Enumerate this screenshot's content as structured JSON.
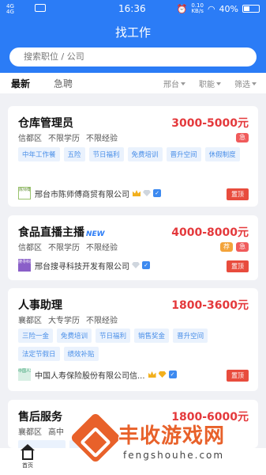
{
  "status_bar": {
    "signal_1": "4G",
    "signal_2": "4G",
    "time": "16:36",
    "speed_value": "0.10",
    "speed_unit": "KB/s",
    "battery": "40%",
    "battery_level": 0.4
  },
  "header": {
    "title": "找工作",
    "search_placeholder": "搜索职位 / 公司"
  },
  "tabs": {
    "latest": "最新",
    "urgent": "急聘",
    "filters": [
      "邢台",
      "职能",
      "筛选"
    ]
  },
  "jobs": [
    {
      "title": "仓库管理员",
      "new_badge": "",
      "salary": "3000-5000元",
      "requirements": [
        "信都区",
        "不限学历",
        "不限经验"
      ],
      "badges": [
        "急"
      ],
      "tags": [
        "中年工作餐",
        "五险",
        "节日福利",
        "免费培训",
        "晋升空间",
        "休假制度"
      ],
      "company": "邢台市陈师傅商贸有限公司",
      "logo_text": "陈师傅",
      "pin_label": "置顶"
    },
    {
      "title": "食品直播主播",
      "new_badge": "NEW",
      "salary": "4000-8000元",
      "requirements": [
        "信都区",
        "不限学历",
        "不限经验"
      ],
      "badges": [
        "荐",
        "急"
      ],
      "tags": [],
      "company": "邢台搜寻科技开发有限公司",
      "logo_text": "搜寻科技",
      "pin_label": "置顶"
    },
    {
      "title": "人事助理",
      "new_badge": "",
      "salary": "1800-3600元",
      "requirements": [
        "襄都区",
        "大专学历",
        "不限经验"
      ],
      "badges": [],
      "tags": [
        "三险一金",
        "免费培训",
        "节日福利",
        "销售奖金",
        "晋升空间",
        "法定节假日",
        "绩效补贴"
      ],
      "company": "中国人寿保险股份有限公司信...",
      "logo_text": "中国人寿",
      "pin_label": "置顶"
    },
    {
      "title": "售后服务",
      "new_badge": "",
      "salary": "1800-6000元",
      "requirements": [
        "襄都区",
        "高中"
      ],
      "badges": [],
      "tags": [],
      "company": "",
      "logo_text": "",
      "pin_label": ""
    }
  ],
  "bottom_nav": {
    "home_label": "首页"
  },
  "watermark": {
    "name": "丰收游戏网",
    "url": "fengshouhe.com"
  },
  "colors": {
    "primary": "#2b7cf6",
    "salary": "#e4393c",
    "pin": "#e84c3d",
    "tag_bg": "#eaf2fd",
    "tag_text": "#4a8fe8",
    "watermark": "#e8612a"
  }
}
